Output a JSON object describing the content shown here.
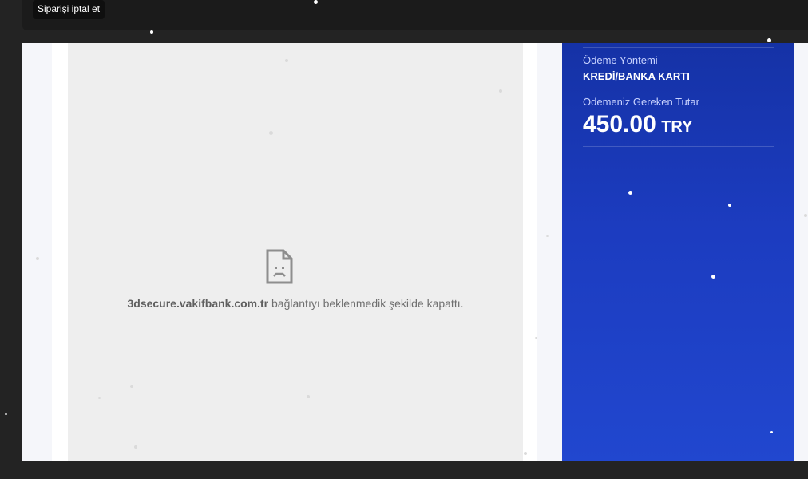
{
  "tooltip": {
    "cancel_order": "Siparişi iptal et"
  },
  "browser_error": {
    "host": "3dsecure.vakifbank.com.tr",
    "message": " bağlantıyı beklenmedik şekilde kapattı.",
    "icon": "sad-document-icon"
  },
  "payment_summary": {
    "method_label": "Ödeme Yöntemi",
    "method_value": "KREDİ/BANKA KARTI",
    "amount_label": "Ödemeniz Gereken Tutar",
    "amount_value": "450.00",
    "currency": "TRY"
  },
  "colors": {
    "panel_blue": "#1c3cc0",
    "page_background": "#f5f6fa",
    "frame_gray": "#eeeeee",
    "dark_chrome": "#1b1b1b"
  }
}
